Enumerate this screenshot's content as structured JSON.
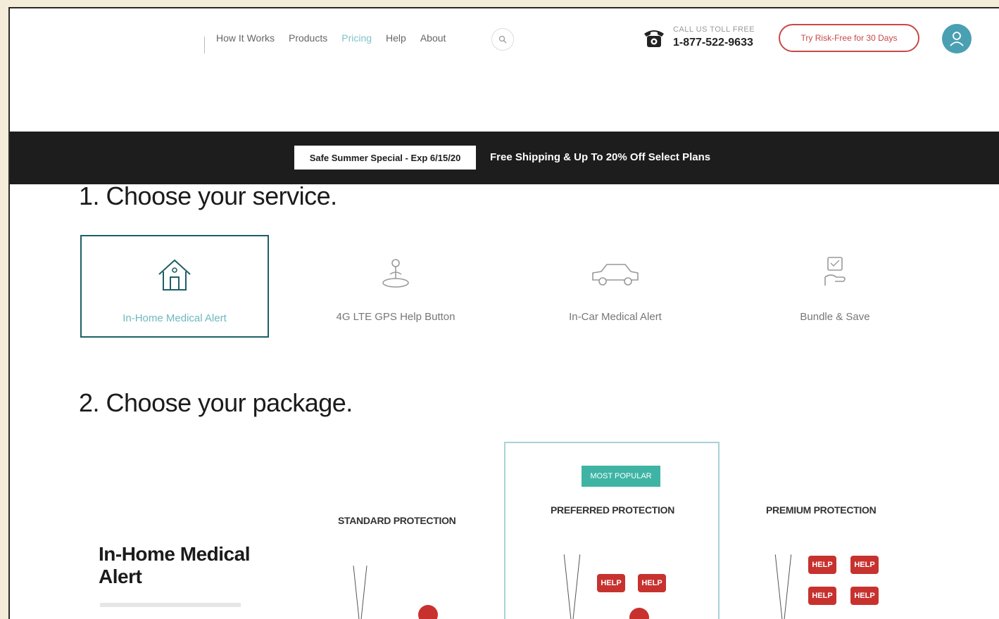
{
  "header": {
    "nav": [
      {
        "label": "How It Works",
        "active": false
      },
      {
        "label": "Products",
        "active": false
      },
      {
        "label": "Pricing",
        "active": true
      },
      {
        "label": "Help",
        "active": false
      },
      {
        "label": "About",
        "active": false
      }
    ],
    "phone_label": "CALL US TOLL FREE",
    "phone_number": "1-877-522-9633",
    "cta_label": "Try Risk-Free for 30 Days"
  },
  "promo": {
    "badge": "Safe Summer Special - Exp 6/15/20",
    "text": "Free Shipping & Up To 20% Off Select Plans"
  },
  "section1": {
    "title": "1. Choose your service.",
    "services": [
      {
        "label": "In-Home Medical Alert",
        "icon": "house-icon",
        "selected": true
      },
      {
        "label": "4G LTE GPS Help Button",
        "icon": "gps-button-icon",
        "selected": false
      },
      {
        "label": "In-Car Medical Alert",
        "icon": "car-icon",
        "selected": false
      },
      {
        "label": "Bundle & Save",
        "icon": "bundle-icon",
        "selected": false
      }
    ]
  },
  "section2": {
    "title": "2. Choose your package.",
    "package_title": "In-Home Medical Alert",
    "packages": [
      {
        "label": "STANDARD PROTECTION"
      },
      {
        "label": "PREFERRED PROTECTION",
        "badge": "MOST POPULAR"
      },
      {
        "label": "PREMIUM PROTECTION"
      }
    ],
    "help_tag": "HELP"
  },
  "colors": {
    "accent_teal": "#1e5e66",
    "badge_green": "#3fb4a4",
    "cta_red": "#c94848",
    "promo_bg": "#1d1d1d"
  }
}
